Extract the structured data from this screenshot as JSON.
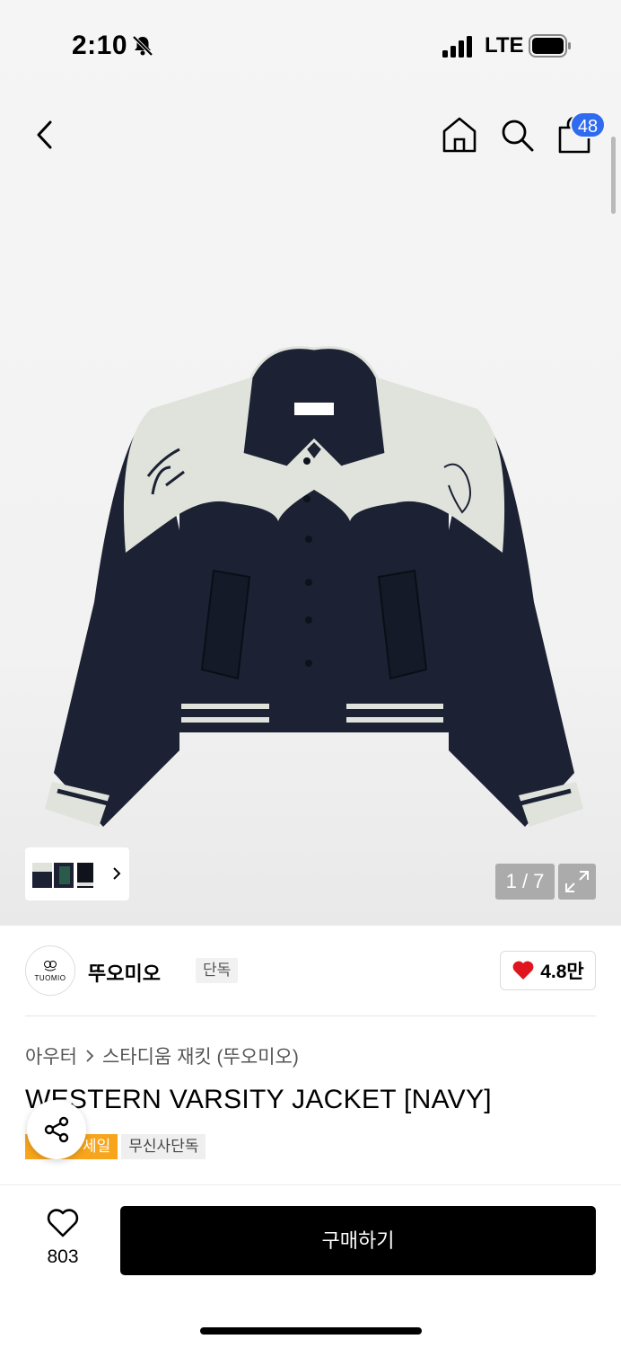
{
  "status": {
    "time": "2:10",
    "network": "LTE"
  },
  "header": {
    "cart_count": "48"
  },
  "gallery": {
    "pager": "1 / 7"
  },
  "brand": {
    "name": "뚜오미오",
    "tag": "단독",
    "logo_text": "TUOMIO",
    "likes": "4.8만"
  },
  "breadcrumb": {
    "category": "아우터",
    "subcategory": "스타디움 재킷 (뚜오미오)"
  },
  "product": {
    "title": "WESTERN VARSITY JACKET [NAVY]",
    "tag_sale": "세일",
    "tag_exclusive": "무신사단독"
  },
  "bottom": {
    "wish_count": "803",
    "buy_label": "구매하기"
  },
  "colors": {
    "navy": "#1c2233",
    "cream": "#dfe3dc",
    "accent": "#2f6bf0",
    "sale": "#f7a51c",
    "heart": "#e0161f"
  },
  "icons": [
    "bell-off-icon",
    "signal-icon",
    "battery-icon",
    "back-icon",
    "home-icon",
    "search-icon",
    "bag-icon",
    "chevron-right-icon",
    "expand-icon",
    "heart-filled-icon",
    "share-icon",
    "heart-outline-icon"
  ]
}
